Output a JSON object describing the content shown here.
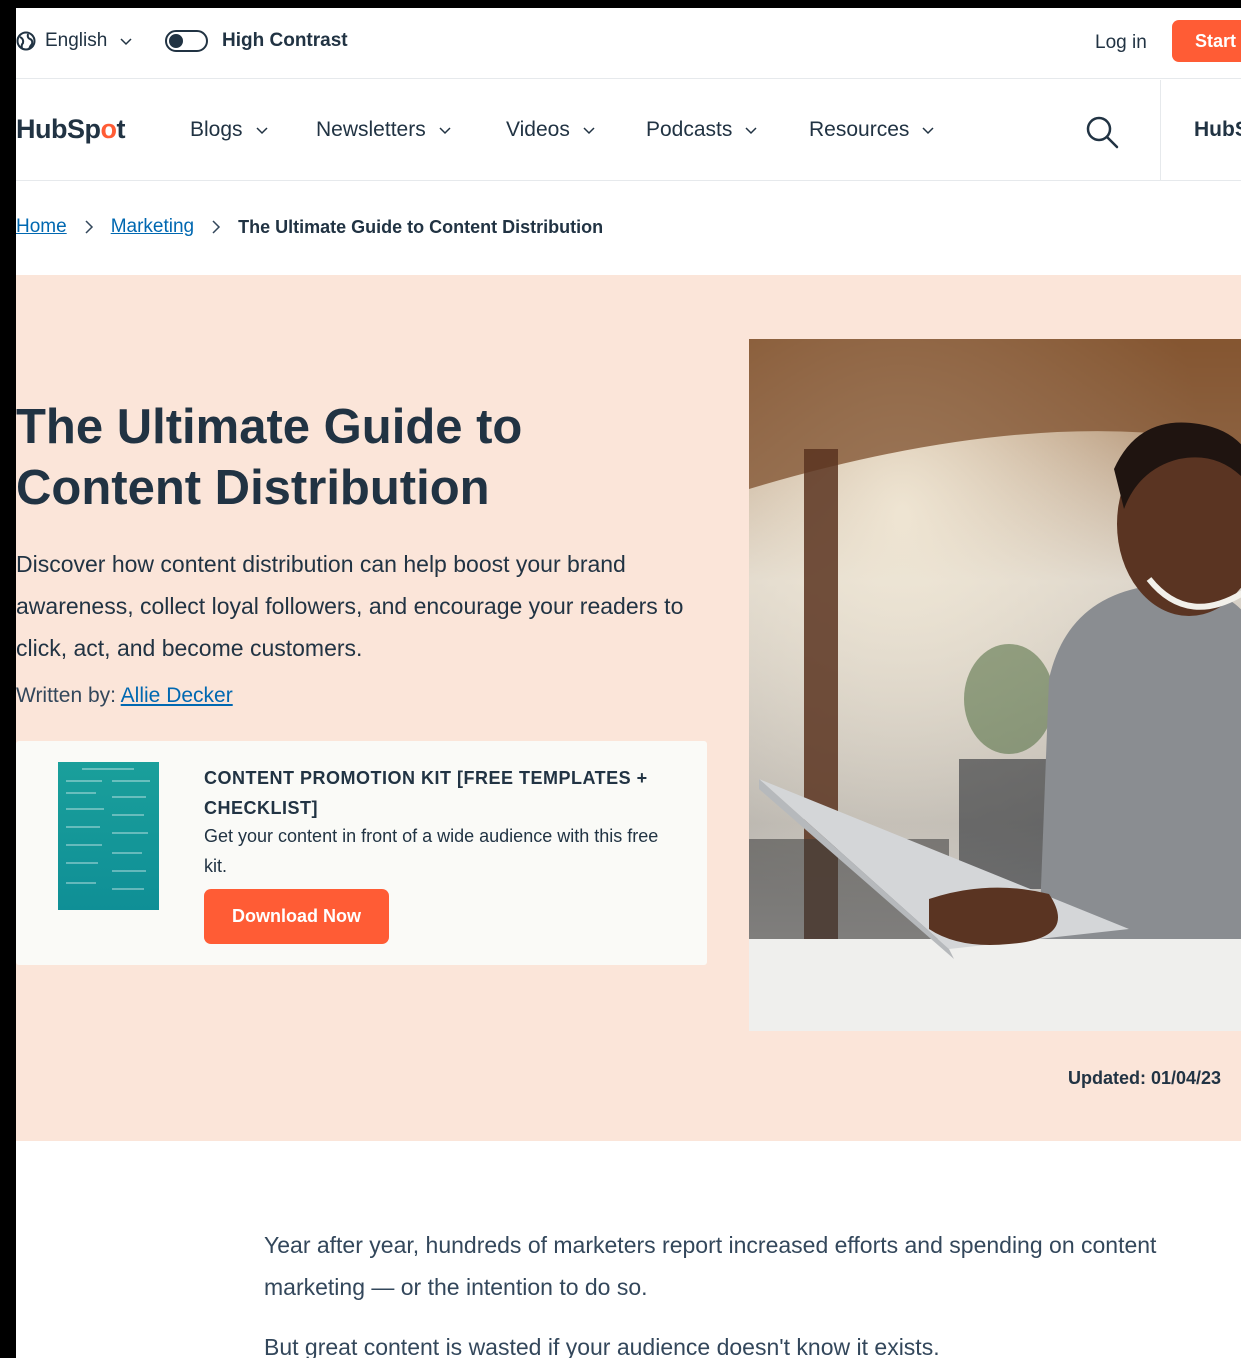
{
  "utility": {
    "language": "English",
    "high_contrast": "High Contrast",
    "login": "Log in",
    "start": "Start"
  },
  "nav": {
    "logo_prefix": "HubSp",
    "logo_o": "o",
    "logo_suffix": "t",
    "items": [
      "Blogs",
      "Newsletters",
      "Videos",
      "Podcasts",
      "Resources"
    ],
    "hubs_label": "HubS"
  },
  "breadcrumb": {
    "home": "Home",
    "marketing": "Marketing",
    "current": "The Ultimate Guide to Content Distribution"
  },
  "hero": {
    "title": "The Ultimate Guide to Content Distribution",
    "description": "Discover how content distribution can help boost your brand awareness, collect loyal followers, and encourage your readers to click, act, and become customers.",
    "byline_label": "Written by:",
    "author": "Allie Decker",
    "updated": "Updated: 01/04/23"
  },
  "offer": {
    "title": "CONTENT PROMOTION KIT [FREE TEMPLATES + CHECKLIST]",
    "description": "Get your content in front of a wide audience with this free kit.",
    "button": "Download Now"
  },
  "body": {
    "p1": "Year after year, hundreds of marketers report increased efforts and spending on content marketing — or the intention to do so.",
    "p2": "But great content is wasted if your audience doesn't know it exists."
  },
  "colors": {
    "accent": "#ff5c35",
    "hero_bg": "#fbe5d9",
    "link": "#0068b1",
    "text": "#213343"
  }
}
